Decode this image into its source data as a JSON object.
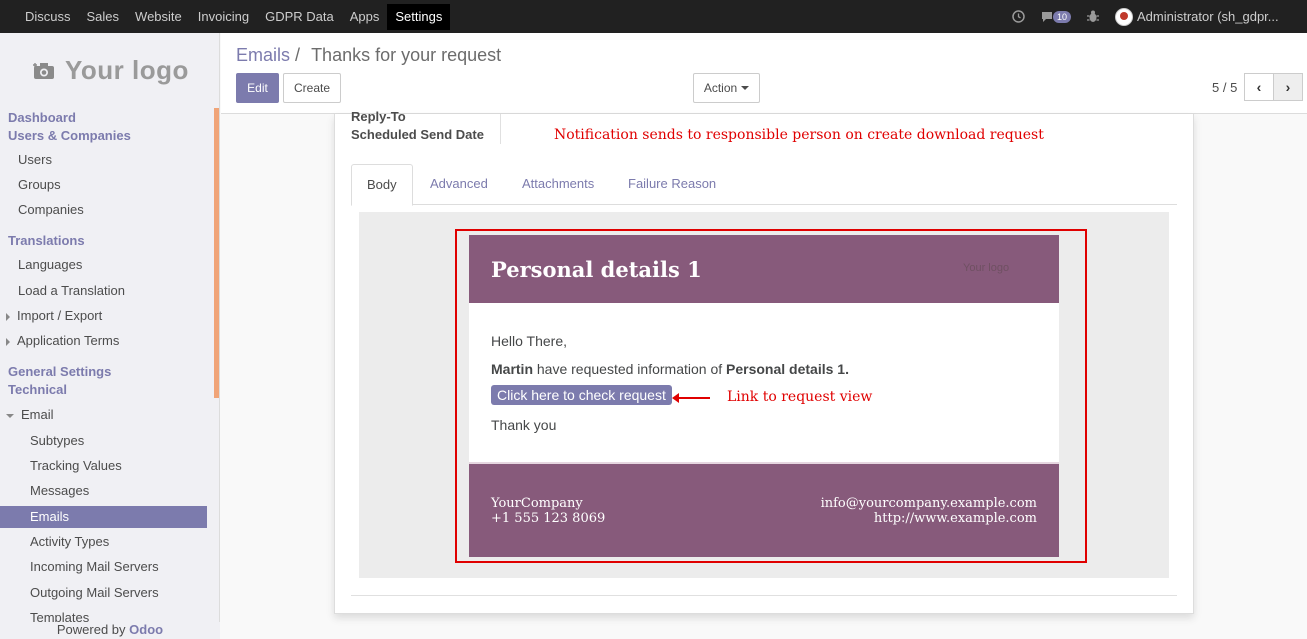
{
  "topbar": {
    "apps": [
      "Discuss",
      "Sales",
      "Website",
      "Invoicing",
      "GDPR Data",
      "Apps",
      "Settings"
    ],
    "active_app": "Settings",
    "messages_count": "10",
    "user": "Administrator (sh_gdpr..."
  },
  "sidebar": {
    "logo_text": "Your logo",
    "items": [
      {
        "label": "Dashboard",
        "kind": "head"
      },
      {
        "label": "Users & Companies",
        "kind": "head"
      },
      {
        "label": "Users",
        "kind": "l1"
      },
      {
        "label": "Groups",
        "kind": "l1"
      },
      {
        "label": "Companies",
        "kind": "l1"
      },
      {
        "label": "Translations",
        "kind": "head"
      },
      {
        "label": "Languages",
        "kind": "l1"
      },
      {
        "label": "Load a Translation",
        "kind": "l1"
      },
      {
        "label": "Import / Export",
        "kind": "l1"
      },
      {
        "label": "Application Terms",
        "kind": "l1"
      },
      {
        "label": "General Settings",
        "kind": "head"
      },
      {
        "label": "Technical",
        "kind": "head"
      },
      {
        "label": "Email",
        "kind": "l1"
      },
      {
        "label": "Subtypes",
        "kind": "l2"
      },
      {
        "label": "Tracking Values",
        "kind": "l2"
      },
      {
        "label": "Messages",
        "kind": "l2"
      },
      {
        "label": "Emails",
        "kind": "l2"
      },
      {
        "label": "Activity Types",
        "kind": "l2"
      },
      {
        "label": "Incoming Mail Servers",
        "kind": "l2"
      },
      {
        "label": "Outgoing Mail Servers",
        "kind": "l2"
      },
      {
        "label": "Templates",
        "kind": "l2"
      }
    ],
    "active_item": "Emails",
    "powered_prefix": "Powered by",
    "powered_brand": "Odoo"
  },
  "control": {
    "breadcrumb_parent": "Emails",
    "breadcrumb_sep": "/",
    "breadcrumb_current": "Thanks for your request",
    "edit_label": "Edit",
    "create_label": "Create",
    "action_label": "Action",
    "pager": "5 / 5"
  },
  "form": {
    "reply_to_label": "Reply-To",
    "scheduled_label": "Scheduled Send Date",
    "annotation_top": "Notification sends to responsible person on create download request",
    "tabs": [
      "Body",
      "Advanced",
      "Attachments",
      "Failure Reason"
    ],
    "active_tab": "Body"
  },
  "email": {
    "title": "Personal details 1",
    "logo_alt": "Your logo",
    "greeting": "Hello There,",
    "requester": "Martin",
    "middle_text": "have requested information of",
    "subject": "Personal details 1.",
    "button_label": "Click here to check request",
    "annotation_link": "Link to request view",
    "closing": "Thank you",
    "company": "YourCompany",
    "phone": "+1 555 123 8069",
    "email": "info@yourcompany.example.com",
    "website": "http://www.example.com"
  },
  "colors": {
    "brand": "#7c7bad",
    "email_header": "#875a7b",
    "annotation": "#e00000",
    "sidebar_accent": "#f0a478"
  }
}
